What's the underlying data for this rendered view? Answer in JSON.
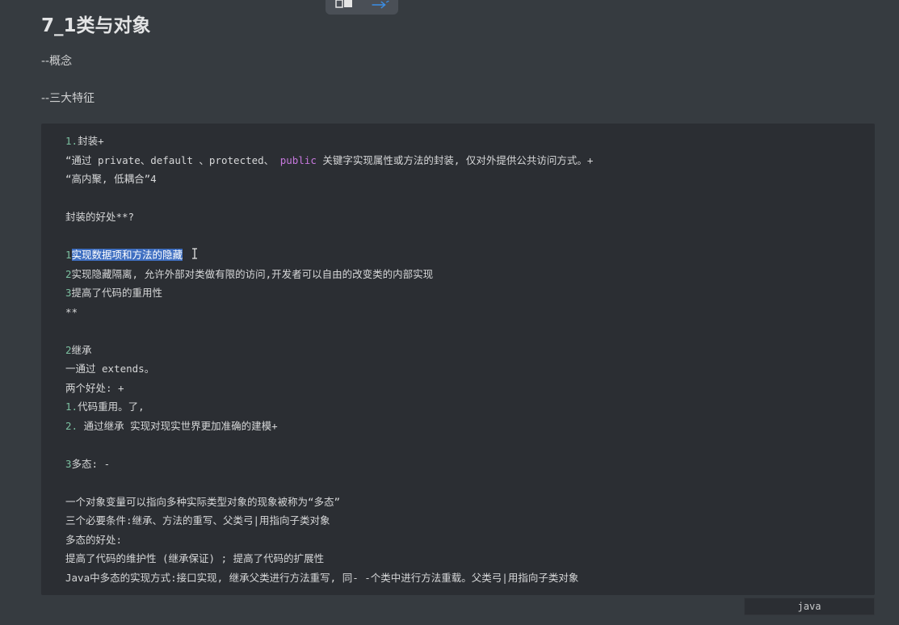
{
  "title": "7_1类与对象",
  "concept": "--概念",
  "features": "--三大特征",
  "code": {
    "l1_num": "1.",
    "l1_text": "封装+",
    "l2_a": "“通过 private、default 、protected、 ",
    "l2_kw": "public",
    "l2_b": " 关键字实现属性或方法的封装, 仅对外提供公共访问方式。+",
    "l3": "“高内聚, 低耦合”4",
    "l5": "封装的好处**?",
    "l7_num": "1",
    "l7_sel": "实现数据项和方法的隐藏",
    "l8_num": "2",
    "l8_text": "实现隐藏隔离, 允许外部对类做有限的访问,开发者可以自由的改变类的内部实现",
    "l9_num": "3",
    "l9_text": "提高了代码的重用性",
    "l10": "**",
    "l12_num": "2",
    "l12_text": "继承",
    "l13": "一通过 extends。",
    "l14": "两个好处: +",
    "l15_num": "1.",
    "l15_text": "代码重用。了,",
    "l16_num": "2.",
    "l16_text": " 通过继承 实现对现实世界更加准确的建模+",
    "l18_num": "3",
    "l18_text": "多态: -",
    "l20": "一个对象变量可以指向多种实际类型对象的现象被称为“多态”",
    "l21": "三个必要条件:继承、方法的重写、父类弓|用指向子类对象",
    "l22": "多态的好处:",
    "l23": "提高了代码的维护性 (继承保证) ; 提高了代码的扩展性",
    "l24": "Java中多态的实现方式:接口实现, 继承父类进行方法重写, 同- -个类中进行方法重载。父类弓|用指向子类对象"
  },
  "language": "java",
  "colors": {
    "background": "#363b40",
    "code_background": "#2b2e33",
    "selection": "#3f6fc1",
    "number": "#7bc0a0",
    "keyword": "#c678dd"
  },
  "icons": {
    "toolbar_left": "window-icon",
    "toolbar_right": "pen-icon",
    "cursor": "text-cursor-icon"
  }
}
